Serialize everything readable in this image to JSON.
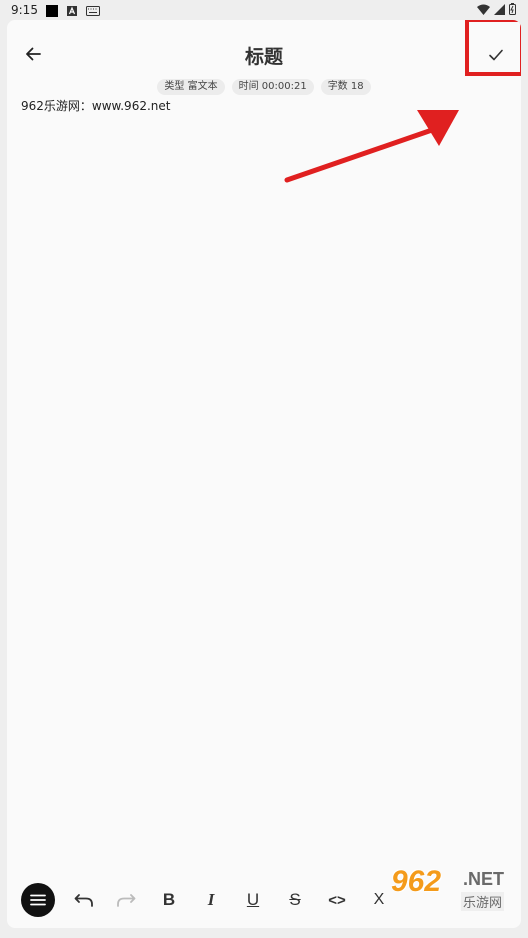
{
  "status_bar": {
    "time": "9:15"
  },
  "header": {
    "title": "标题"
  },
  "meta_chips": [
    "类型 富文本",
    "时间 00:00:21",
    "字数 18"
  ],
  "editor": {
    "content": "962乐游网：www.962.net"
  },
  "toolbar": {
    "bold": "B",
    "italic": "I",
    "underline": "U",
    "strikethrough": "S",
    "code": "<>",
    "subscript": "X"
  },
  "watermark": {
    "number": "962",
    "suffix": ".NET",
    "name": "乐游网"
  },
  "colors": {
    "annotation": "#e02020",
    "background": "#fafafa"
  }
}
